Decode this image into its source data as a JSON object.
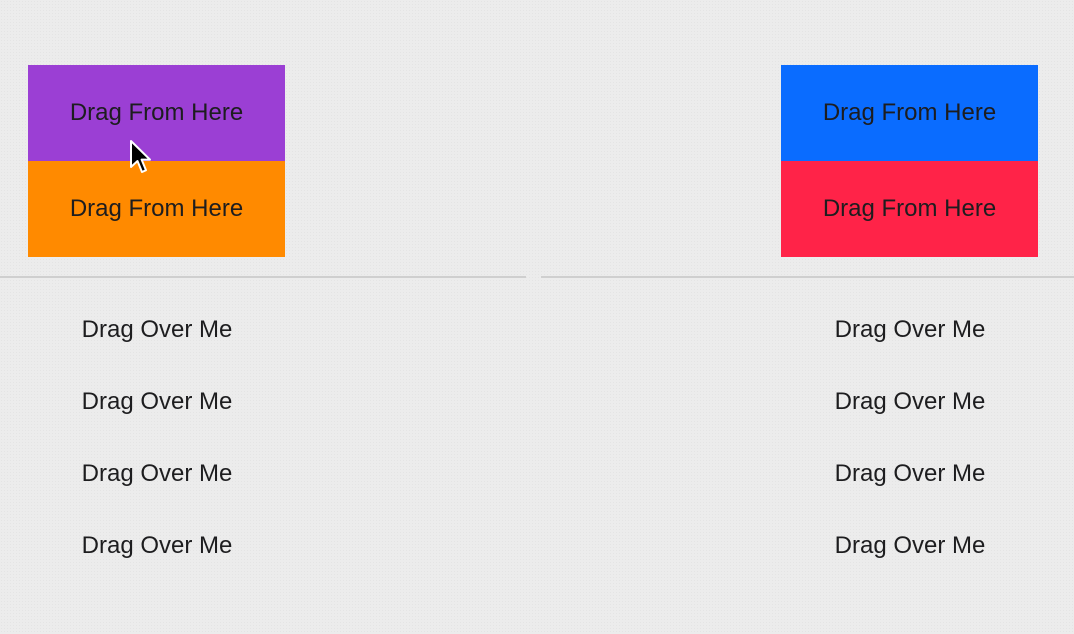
{
  "left_panel": {
    "sources": [
      {
        "label": "Drag From Here",
        "color": "#9b3fd4"
      },
      {
        "label": "Drag From Here",
        "color": "#ff8a00"
      }
    ],
    "targets": [
      {
        "label": "Drag Over Me"
      },
      {
        "label": "Drag Over Me"
      },
      {
        "label": "Drag Over Me"
      },
      {
        "label": "Drag Over Me"
      }
    ]
  },
  "right_panel": {
    "sources": [
      {
        "label": "Drag From Here",
        "color": "#0a6cff"
      },
      {
        "label": "Drag From Here",
        "color": "#ff2348"
      }
    ],
    "targets": [
      {
        "label": "Drag Over Me"
      },
      {
        "label": "Drag Over Me"
      },
      {
        "label": "Drag Over Me"
      },
      {
        "label": "Drag Over Me"
      }
    ]
  },
  "colors": {
    "background": "#ececec",
    "divider": "#cfcfcf",
    "text": "#1d1d1f"
  },
  "cursor": {
    "icon": "arrow-pointer-icon"
  }
}
